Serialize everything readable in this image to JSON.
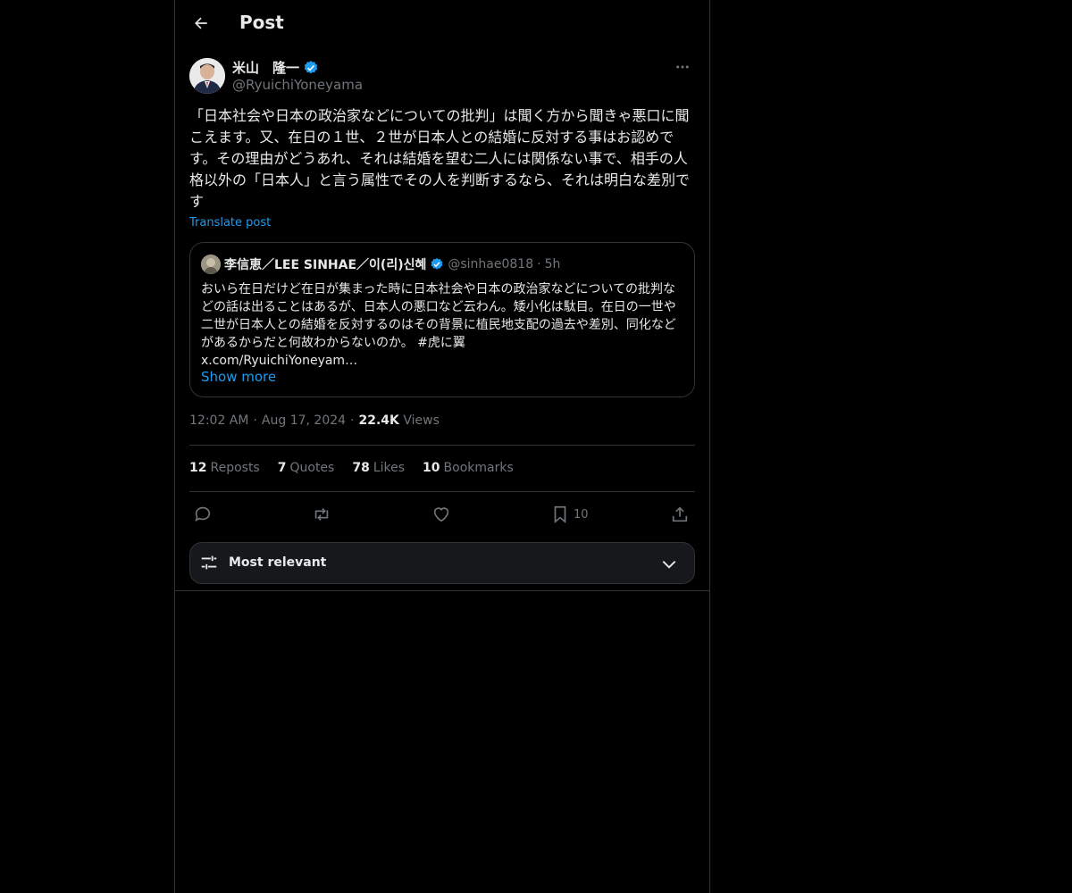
{
  "header": {
    "title": "Post"
  },
  "author": {
    "name": "米山　隆一",
    "handle": "@RyuichiYoneyama"
  },
  "post": {
    "text": "「日本社会や日本の政治家などについての批判」は聞く方から聞きゃ悪口に聞こえます。又、在日の１世、２世が日本人との結婚に反対する事はお認めです。その理由がどうあれ、それは結婚を望む二人には関係ない事で、相手の人格以外の「日本人」と言う属性でその人を判断するなら、それは明白な差別です",
    "translate_label": "Translate post"
  },
  "quote": {
    "name": "李信恵／LEE SINHAE／이(리)신혜",
    "handle": "@sinhae0818",
    "separator": "·",
    "time": "5h",
    "text": "おいら在日だけど在日が集まった時に日本社会や日本の政治家などについての批判などの話は出ることはあるが、日本人の悪口など云わん。矮小化は駄目。在日の一世や二世が日本人との結婚を反対するのはその背景に植民地支配の過去や差別、同化などがあるからだと何故わからないのか。 #虎に翼\nx.com/RyuichiYoneyam…",
    "show_more": "Show more"
  },
  "meta": {
    "time": "12:02 AM",
    "dot": "·",
    "date": "Aug 17, 2024",
    "views_count": "22.4K",
    "views_label": "Views"
  },
  "stats": {
    "reposts_count": "12",
    "reposts_label": "Reposts",
    "quotes_count": "7",
    "quotes_label": "Quotes",
    "likes_count": "78",
    "likes_label": "Likes",
    "bookmarks_count": "10",
    "bookmarks_label": "Bookmarks"
  },
  "actions": {
    "bookmark_count": "10"
  },
  "sort": {
    "label": "Most relevant"
  },
  "colors": {
    "accent": "#1d9bf0",
    "muted": "#71767b",
    "text": "#e7e9ea",
    "border": "#2f3336"
  }
}
